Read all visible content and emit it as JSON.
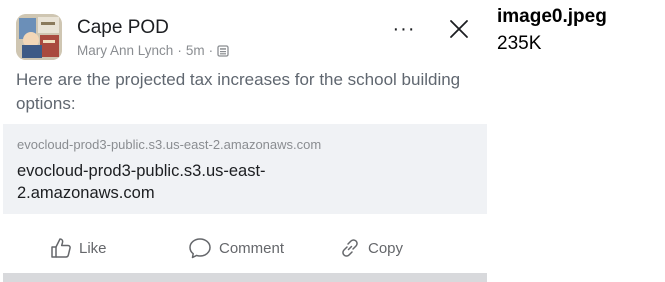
{
  "post": {
    "group_name": "Cape POD",
    "author": "Mary Ann Lynch",
    "separator": "·",
    "time": "5m",
    "audience_icon": "group-icon",
    "more_label": "···",
    "text": "Here are the projected tax increases for the school building options:",
    "link": {
      "domain": "evocloud-prod3-public.s3.us-east-2.amazonaws.com",
      "title": "evocloud-prod3-public.s3.us-east-2.amazonaws.com"
    },
    "actions": {
      "like": "Like",
      "comment": "Comment",
      "copy": "Copy"
    }
  },
  "attachment": {
    "file_name": "image0.jpeg",
    "file_size": "235K"
  },
  "colors": {
    "text_primary": "#1c1e21",
    "text_secondary": "#8a8d91",
    "card_bg": "#f0f2f5"
  }
}
